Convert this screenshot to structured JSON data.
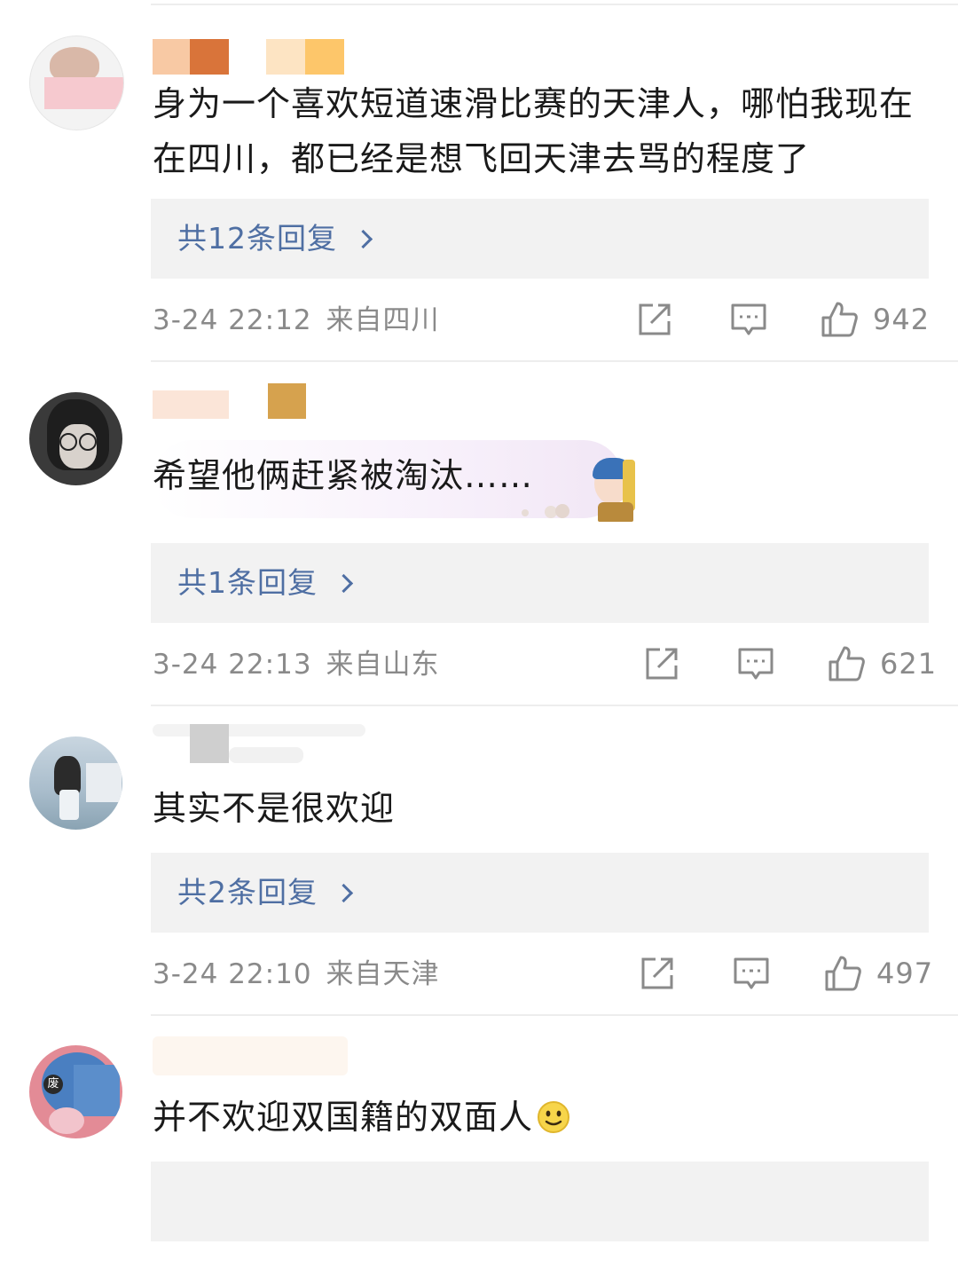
{
  "comments": [
    {
      "text": "身为一个喜欢短道速滑比赛的天津人，哪怕我现在在四川，都已经是想飞回天津去骂的程度了",
      "replies_label": "共12条回复",
      "time": "3-24 22:12",
      "location": "来自四川",
      "likes": "942"
    },
    {
      "text": "希望他俩赶紧被淘汰……",
      "replies_label": "共1条回复",
      "time": "3-24 22:13",
      "location": "来自山东",
      "likes": "621"
    },
    {
      "text": "其实不是很欢迎",
      "replies_label": "共2条回复",
      "time": "3-24 22:10",
      "location": "来自天津",
      "likes": "497"
    },
    {
      "text": "并不欢迎双国籍的双面人"
    }
  ],
  "avatar_badge": "废",
  "icons": {
    "share": "share-icon",
    "comment": "comment-icon",
    "like": "thumbs-up-icon",
    "emoji": "smiley-emoji-icon",
    "sticker": "pearl-earring-girl-sticker"
  },
  "colors": {
    "link": "#4f6fa3",
    "meta": "#8a8a8a",
    "reply_bg": "#f2f2f2"
  }
}
